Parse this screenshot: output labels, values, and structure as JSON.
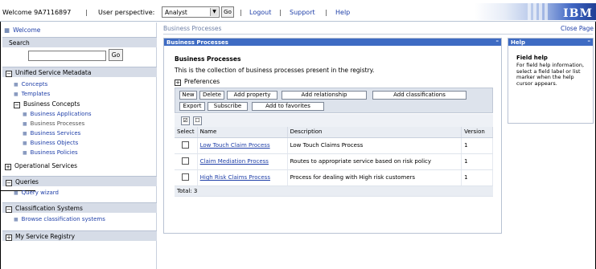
{
  "topbar": {
    "welcome": "Welcome 9A7116897",
    "sep": "|",
    "perspective_label": "User perspective:",
    "perspective_value": "Analyst",
    "go": "Go",
    "links": [
      "Logout",
      "Support",
      "Help"
    ],
    "logo": "IBM",
    "banner_color": "#3f66c4"
  },
  "nav": {
    "welcome": "Welcome",
    "search_title": "Search",
    "search_go": "Go",
    "usm_title": "Unified Service Metadata",
    "usm_items": [
      "Concepts",
      "Templates"
    ],
    "business_concepts": "Business Concepts",
    "business_items": [
      "Business Applications",
      "Business Processes",
      "Business Services",
      "Business Objects",
      "Business Policies"
    ],
    "operational_services": "Operational Services",
    "queries_title": "Queries",
    "query_wizard": "Query wizard",
    "classification_title": "Classification Systems",
    "browse_classification": "Browse classification systems",
    "my_registry": "My Service Registry",
    "expand_glyph": "+",
    "collapse_glyph": "−"
  },
  "main": {
    "breadcrumb": "Business Processes",
    "close_page": "Close Page",
    "portlet_title": "Business Processes",
    "heading": "Business Processes",
    "description": "This is the collection of business processes present in the registry.",
    "preferences": "Preferences",
    "buttons": [
      "New",
      "Delete",
      "Add property",
      "Add relationship",
      "Add classifications",
      "Export",
      "Subscribe",
      "Add to favorites"
    ],
    "table": {
      "headers": [
        "Select",
        "Name",
        "Description",
        "Version"
      ],
      "rows": [
        {
          "name": "Low Touch Claim Process",
          "description": "Low Touch Claims Process",
          "version": "1"
        },
        {
          "name": "Claim Mediation Process",
          "description": "Routes to appropriate service based on risk policy",
          "version": "1"
        },
        {
          "name": "High Risk Claims Process",
          "description": "Process for dealing with High risk customers",
          "version": "1"
        }
      ],
      "total": "Total: 3"
    }
  },
  "help": {
    "title": "Help",
    "heading": "Field help",
    "text": "For field help information, select a field label or list marker when the help cursor appears."
  }
}
